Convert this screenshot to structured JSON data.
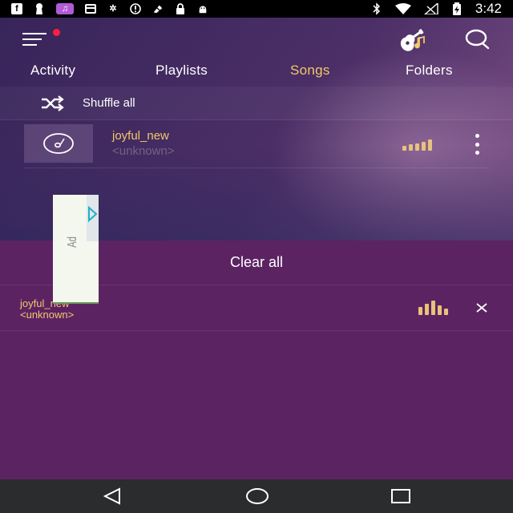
{
  "status_bar": {
    "time": "3:42",
    "icons": [
      "facebook-icon",
      "keyhole-icon",
      "music-note-icon",
      "card-icon",
      "bluetooth-settings-icon",
      "alert-circle-icon",
      "no-sim-icon",
      "lock-icon",
      "android-icon",
      "bluetooth-icon",
      "wifi-icon",
      "signal-icon",
      "battery-icon"
    ]
  },
  "toolbar": {
    "menu_icon": "hamburger-menu-icon",
    "guitar_icon": "guitar-icon",
    "search_icon": "search-icon"
  },
  "tabs": [
    {
      "label": "Activity",
      "active": false
    },
    {
      "label": "Playlists",
      "active": false
    },
    {
      "label": "Songs",
      "active": true
    },
    {
      "label": "Folders",
      "active": false
    }
  ],
  "shuffle": {
    "label": "Shuffle all",
    "icon": "shuffle-icon"
  },
  "songs": [
    {
      "title": "joyful_new",
      "artist": "<unknown>"
    }
  ],
  "queue": {
    "clear_label": "Clear all",
    "items": [
      {
        "title": "joyful_new",
        "artist": "<unknown>"
      }
    ]
  },
  "ad": {
    "label": "Ad"
  },
  "nav_bar": {
    "buttons": [
      "back-icon",
      "home-icon",
      "recents-icon"
    ]
  },
  "colors": {
    "accent": "#f2c86a",
    "queue_bg": "#5c2363",
    "nav_bg": "#2a2c2e"
  }
}
